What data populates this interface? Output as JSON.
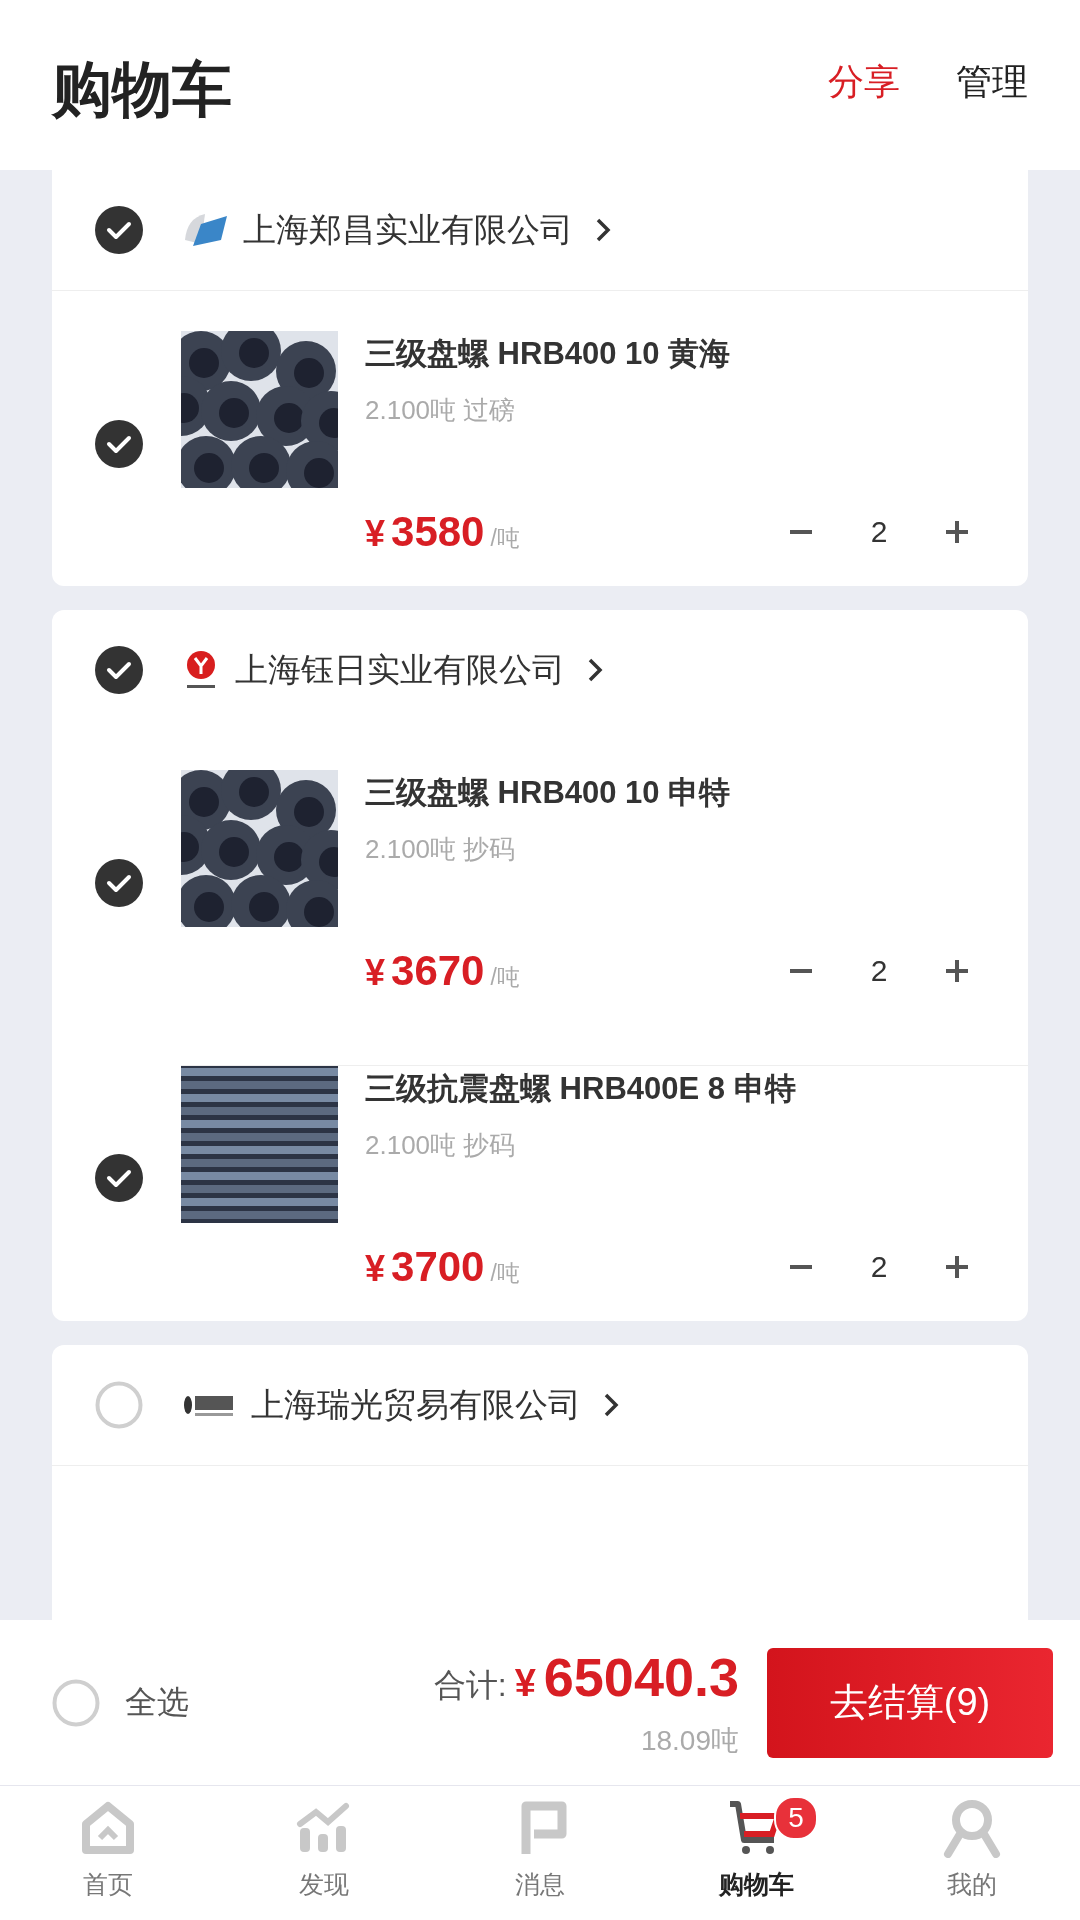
{
  "header": {
    "title": "购物车",
    "actions": [
      {
        "label": "分享",
        "kind": "accent"
      },
      {
        "label": "管理",
        "kind": "plain"
      }
    ]
  },
  "shops": [
    {
      "name": "上海郑昌实业有限公司",
      "checked": true,
      "items": [
        {
          "title": "三级盘螺 HRB400 10 黄海",
          "spec": "2.100吨 过磅",
          "currency": "¥",
          "price": "3580",
          "unit": "/吨",
          "quantity": "2",
          "checked": true
        }
      ]
    },
    {
      "name": "上海钰日实业有限公司",
      "checked": true,
      "items": [
        {
          "title": "三级盘螺 HRB400 10 申特",
          "spec": "2.100吨 抄码",
          "currency": "¥",
          "price": "3670",
          "unit": "/吨",
          "quantity": "2",
          "checked": true
        },
        {
          "title": "三级抗震盘螺 HRB400E 8 申特",
          "spec": "2.100吨 抄码",
          "currency": "¥",
          "price": "3700",
          "unit": "/吨",
          "quantity": "2",
          "checked": true
        }
      ]
    },
    {
      "name": "上海瑞光贸易有限公司",
      "checked": false
    }
  ],
  "footer": {
    "select_all": {
      "label": "全选",
      "checked": false
    },
    "total_label": "合计:",
    "currency": "¥",
    "total": "65040.3",
    "weight": "18.09吨",
    "checkout": "去结算(9)"
  },
  "tabs": [
    {
      "label": "首页",
      "selected": false
    },
    {
      "label": "发现",
      "selected": false
    },
    {
      "label": "消息",
      "selected": false
    },
    {
      "label": "购物车",
      "selected": true,
      "badge": "5"
    },
    {
      "label": "我的",
      "selected": false
    }
  ]
}
